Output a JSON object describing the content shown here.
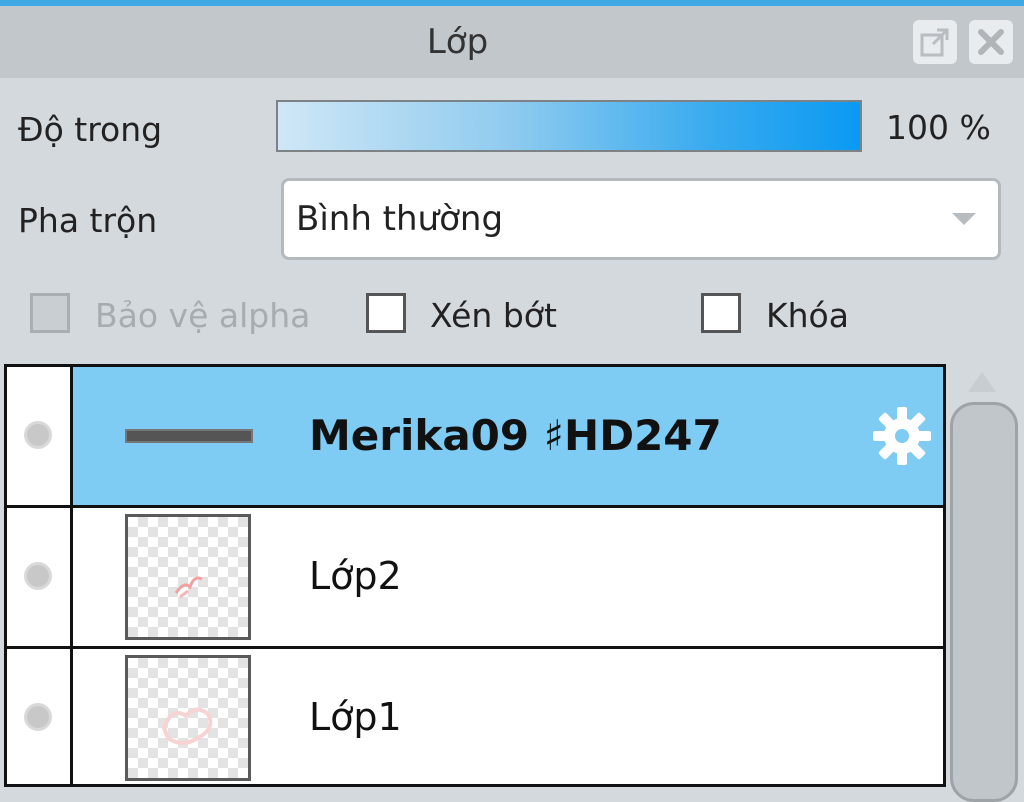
{
  "panel": {
    "title": "Lớp",
    "buttons": {
      "popout_icon": "popout-icon",
      "close_icon": "close-icon"
    }
  },
  "opacity": {
    "label": "Độ trong",
    "value_text": "100 %",
    "value": 100
  },
  "blend": {
    "label": "Pha trộn",
    "selected": "Bình thường"
  },
  "options": [
    {
      "label": "Bảo vệ alpha",
      "checked": false,
      "enabled": false
    },
    {
      "label": "Xén bớt",
      "checked": false,
      "enabled": true
    },
    {
      "label": "Khóa",
      "checked": false,
      "enabled": true
    }
  ],
  "layers": [
    {
      "name": "Merika09 ♯HD247",
      "selected": true,
      "is_folder": true,
      "icon": "gear-icon"
    },
    {
      "name": "Lớp2",
      "selected": false
    },
    {
      "name": "Lớp1",
      "selected": false
    }
  ],
  "colors": {
    "accent": "#3fa9e6",
    "selected_row": "#7ecbf3",
    "panel_bg": "#d4d9de"
  }
}
